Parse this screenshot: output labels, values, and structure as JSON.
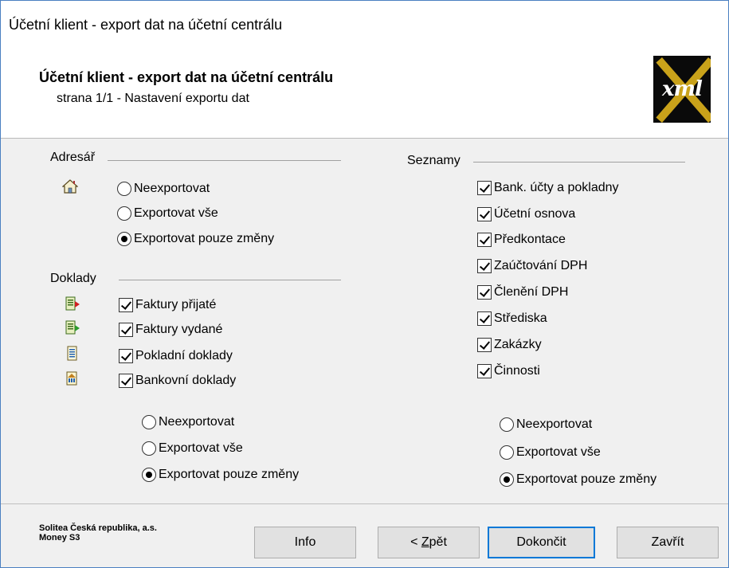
{
  "window": {
    "title": "Účetní klient - export dat na účetní centrálu"
  },
  "header": {
    "title": "Účetní klient - export dat na účetní centrálu",
    "subtitle": "strana 1/1 - Nastavení exportu dat",
    "logo_text": "xml",
    "logo_icon": "xml-logo-icon"
  },
  "adresar": {
    "label": "Adresář",
    "icon": "house-icon",
    "options": [
      {
        "label": "Neexportovat",
        "selected": false
      },
      {
        "label": "Exportovat vše",
        "selected": false
      },
      {
        "label": "Exportovat pouze změny",
        "selected": true
      }
    ]
  },
  "doklady": {
    "label": "Doklady",
    "items": [
      {
        "label": "Faktury přijaté",
        "checked": true,
        "icon": "received-invoice-icon"
      },
      {
        "label": "Faktury vydané",
        "checked": true,
        "icon": "issued-invoice-icon"
      },
      {
        "label": "Pokladní doklady",
        "checked": true,
        "icon": "cash-document-icon"
      },
      {
        "label": "Bankovní doklady",
        "checked": true,
        "icon": "bank-document-icon"
      }
    ],
    "options": [
      {
        "label": "Neexportovat",
        "selected": false
      },
      {
        "label": "Exportovat vše",
        "selected": false
      },
      {
        "label": "Exportovat pouze změny",
        "selected": true
      }
    ]
  },
  "seznamy": {
    "label": "Seznamy",
    "items": [
      {
        "label": "Bank. účty a pokladny",
        "checked": true
      },
      {
        "label": "Účetní osnova",
        "checked": true
      },
      {
        "label": "Předkontace",
        "checked": true
      },
      {
        "label": "Zaúčtování DPH",
        "checked": true
      },
      {
        "label": "Členění DPH",
        "checked": true
      },
      {
        "label": "Střediska",
        "checked": true
      },
      {
        "label": "Zakázky",
        "checked": true
      },
      {
        "label": "Činnosti",
        "checked": true
      }
    ],
    "options": [
      {
        "label": "Neexportovat",
        "selected": false
      },
      {
        "label": "Exportovat vše",
        "selected": false
      },
      {
        "label": "Exportovat pouze změny",
        "selected": true
      }
    ]
  },
  "footer": {
    "company_line1": "Solitea Česká republika, a.s.",
    "company_line2": "Money S3",
    "buttons": {
      "info": "Info",
      "back_prefix": "< ",
      "back_underlined": "Z",
      "back_rest": "pět",
      "finish": "Dokončit",
      "close": "Zavřít"
    }
  },
  "colors": {
    "accent": "#0078d7",
    "logo_gold": "#c9a21a"
  }
}
